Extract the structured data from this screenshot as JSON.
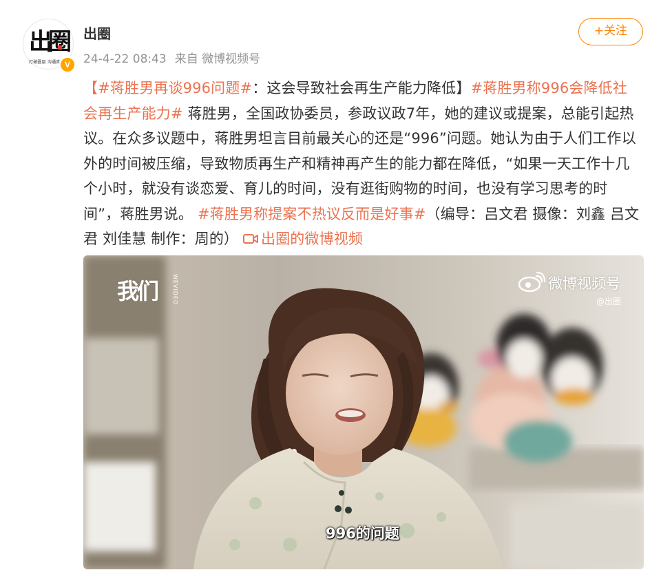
{
  "account": {
    "name": "出圈",
    "avatar_text": "出圈",
    "avatar_tagline": "打破圈层 沟通真实",
    "verified_badge": "V",
    "timestamp": "24-4-22 08:43",
    "source": "来自 微博视频号"
  },
  "follow_button": {
    "label": "+关注"
  },
  "post": {
    "tag1": "【#蒋胜男再谈996问题#",
    "text1": "：这会导致社会再生产能力降低】",
    "tag2": "#蒋胜男称996会降低社会再生产能力#",
    "text2": " 蒋胜男，全国政协委员，参政议政7年，她的建议或提案，总能引起热议。在众多议题中，蒋胜男坦言目前最关心的还是“996”问题。她认为由于人们工作以外的时间被压缩，导致物质再生产和精神再产生的能力都在降低，“如果一天工作十几个小时，就没有谈恋爱、育儿的时间，没有逛街购物的时间，也没有学习思考的时间”，蒋胜男说。",
    "tag3": "#蒋胜男称提案不热议反而是好事#",
    "text3": "（编导：吕文君 摄像：刘鑫  吕文君 刘佳慧 制作：周的）",
    "video_link": "出圈的微博视频",
    "video_link_icon": "video-camera-icon"
  },
  "video": {
    "brand_logo": "我们",
    "brand_sub": "WEVIDEO",
    "watermark": "微博视频号",
    "watermark_handle": "@出圈",
    "watermark_icon": "weibo-icon",
    "subtitle": "996的问题"
  },
  "colors": {
    "accent": "#ff8200",
    "link": "#eb7350",
    "meta": "#939393",
    "text": "#333333"
  }
}
